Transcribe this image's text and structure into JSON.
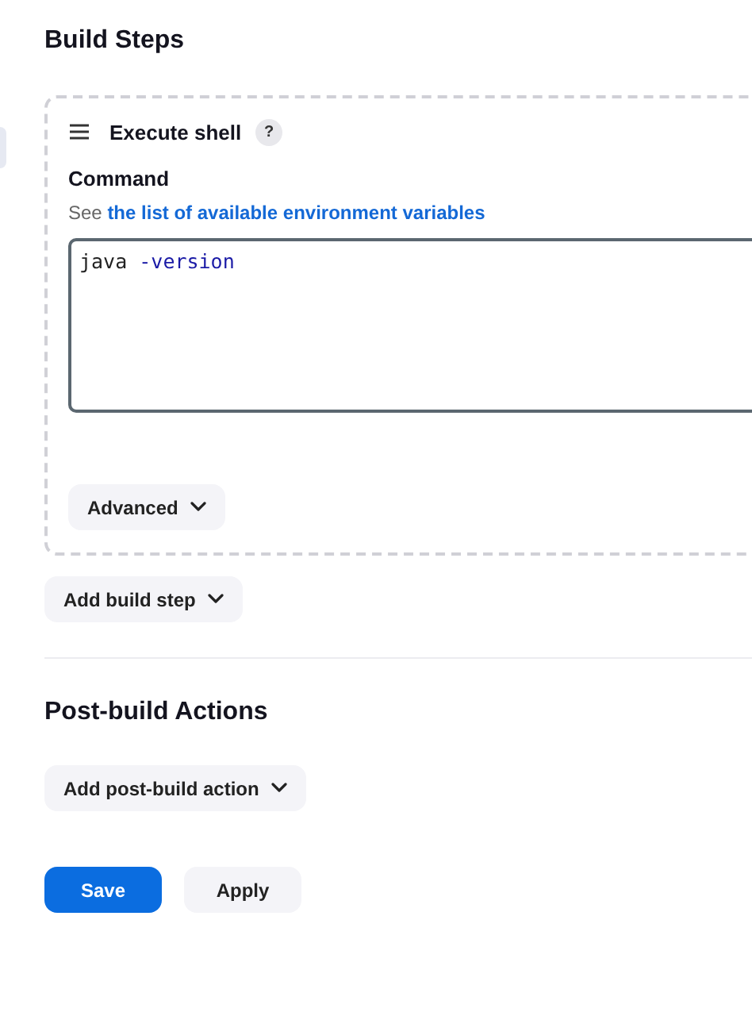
{
  "build_steps": {
    "title": "Build Steps",
    "steps": [
      {
        "title": "Execute shell",
        "help": "?",
        "field_label": "Command",
        "hint": "See ",
        "hint_link": "the list of available environment variables",
        "command": [
          {
            "text": "java ",
            "kind": "plain"
          },
          {
            "text": "-version",
            "kind": "option"
          }
        ],
        "advanced": "Advanced"
      }
    ],
    "add_button": "Add build step"
  },
  "post_build": {
    "title": "Post-build Actions",
    "add_button": "Add post-build action"
  },
  "buttons": [
    {
      "label": "Save",
      "kind": "primary"
    },
    {
      "label": "Apply",
      "kind": "secondary"
    }
  ]
}
